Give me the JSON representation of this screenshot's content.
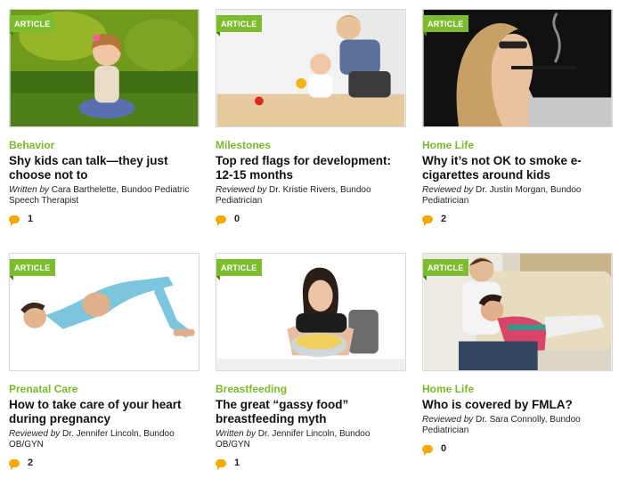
{
  "cards": [
    {
      "badge": "ARTICLE",
      "category": "Behavior",
      "title": "Shy kids can talk—they just choose not to",
      "byline_prefix": "Written by",
      "byline_rest": " Cara Barthelette, Bundoo Pediatric Speech Therapist",
      "comments": "1"
    },
    {
      "badge": "ARTICLE",
      "category": "Milestones",
      "title": "Top red flags for development: 12-15 months",
      "byline_prefix": "Reviewed by",
      "byline_rest": " Dr. Kristie Rivers, Bundoo Pediatrician",
      "comments": "0"
    },
    {
      "badge": "ARTICLE",
      "category": "Home Life",
      "title": "Why it’s not OK to smoke e-cigarettes around kids",
      "byline_prefix": "Reviewed by",
      "byline_rest": " Dr. Justin Morgan, Bundoo Pediatrician",
      "comments": "2"
    },
    {
      "badge": "ARTICLE",
      "category": "Prenatal Care",
      "title": "How to take care of your heart during pregnancy",
      "byline_prefix": "Reviewed by",
      "byline_rest": " Dr. Jennifer Lincoln, Bundoo OB/GYN",
      "comments": "2"
    },
    {
      "badge": "ARTICLE",
      "category": "Breastfeeding",
      "title": "The great “gassy food” breastfeeding myth",
      "byline_prefix": "Written by",
      "byline_rest": " Dr. Jennifer Lincoln, Bundoo OB/GYN",
      "comments": "1"
    },
    {
      "badge": "ARTICLE",
      "category": "Home Life",
      "title": "Who is covered by FMLA?",
      "byline_prefix": "Reviewed by",
      "byline_rest": " Dr. Sara Connolly, Bundoo Pediatrician",
      "comments": "0"
    }
  ],
  "colors": {
    "accent_green": "#7ab929",
    "badge_green": "#7dbb2f",
    "comment_orange": "#f2a900"
  },
  "icons": {
    "comment": "comment-bubble-icon"
  }
}
